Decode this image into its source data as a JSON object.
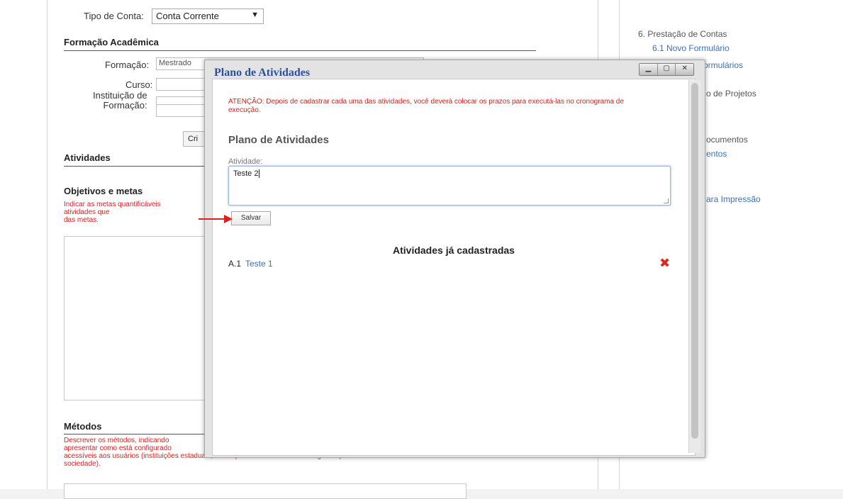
{
  "form": {
    "tipo_conta_label": "Tipo de Conta:",
    "tipo_conta_value": "Conta Corrente",
    "formacao_title": "Formação Acadêmica",
    "formacao_label": "Formação:",
    "formacao_value": "Mestrado",
    "curso_label": "Curso:",
    "instituicao_label_1": "Instituição de",
    "instituicao_label_2": "Formação:",
    "criar_button": "Cri",
    "atividades_title": "Atividades",
    "objetivos_title": "Objetivos e metas",
    "objetivos_hint": [
      "Indicar as metas quantificáveis",
      "atividades que ",
      "das metas."
    ],
    "metodos_title": "Métodos",
    "metodos_hint": [
      "Descrever os métodos, indicando",
      "apresentar como está configurado",
      "acessíveis aos usuários (instituições estaduais, municipais e federais e outras organizações da",
      "sociedade)."
    ]
  },
  "nav": {
    "section6": "6. Prestação de Contas",
    "item61": "6.1 Novo Formulário",
    "item62_partial": "ormulários",
    "item7_partial": "o de Projetos",
    "item8_partial": "ocumentos",
    "item81_partial": "entos",
    "item9_partial": "ara Impressão"
  },
  "dialog": {
    "title": "Plano de Atividades",
    "warning": "ATENÇÃO: Depois de cadastrar cada uma das atividades, você deverá colocar os prazos para executá-las no cronograma de execução.",
    "heading": "Plano de Atividades",
    "atividade_label": "Atividade:",
    "atividade_value": "Teste 2",
    "save_button": "Salvar",
    "list_heading": "Atividades já cadastradas",
    "items": [
      {
        "code": "A.1",
        "name": "Teste 1"
      }
    ]
  },
  "colors": {
    "hint_red": "#e02020",
    "link_blue": "#3a72b8",
    "title_blue": "#2d5199",
    "delete_red": "#e32222"
  },
  "icons": {
    "select_arrow": "triangle-down",
    "delete": "red-x",
    "annotation_arrow": "red-arrow-right"
  }
}
